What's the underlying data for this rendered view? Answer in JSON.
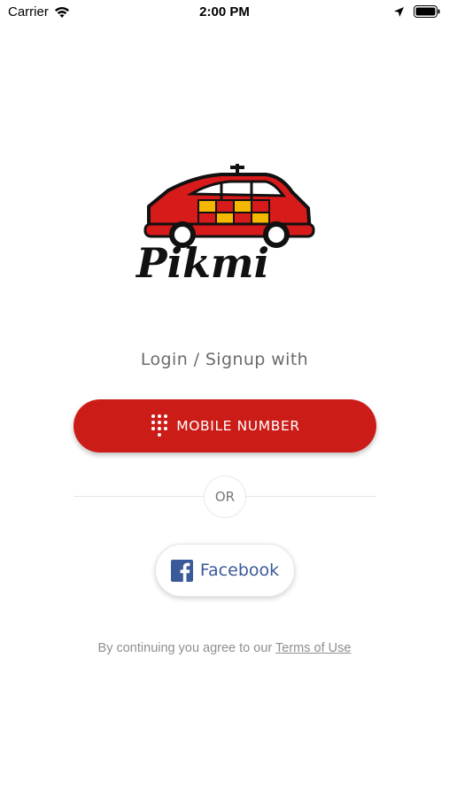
{
  "status_bar": {
    "carrier": "Carrier",
    "time": "2:00 PM",
    "icons": [
      "wifi-icon",
      "location-arrow-icon",
      "battery-icon"
    ]
  },
  "logo": {
    "text": "Pikmi",
    "icon": "taxi-car-icon",
    "colors": {
      "body": "#d71a1a",
      "windows": "#f5b800",
      "outline": "#111111"
    }
  },
  "login": {
    "label": "Login / Signup with"
  },
  "mobile_button": {
    "label": "MOBILE NUMBER",
    "icon": "dialpad-icon",
    "color": "#cc1c17"
  },
  "divider": {
    "label": "OR"
  },
  "facebook_button": {
    "label": "Facebook",
    "icon": "facebook-icon",
    "color": "#3b5a9a"
  },
  "terms": {
    "prefix": "By continuing you agree to our",
    "link": "Terms of Use"
  }
}
